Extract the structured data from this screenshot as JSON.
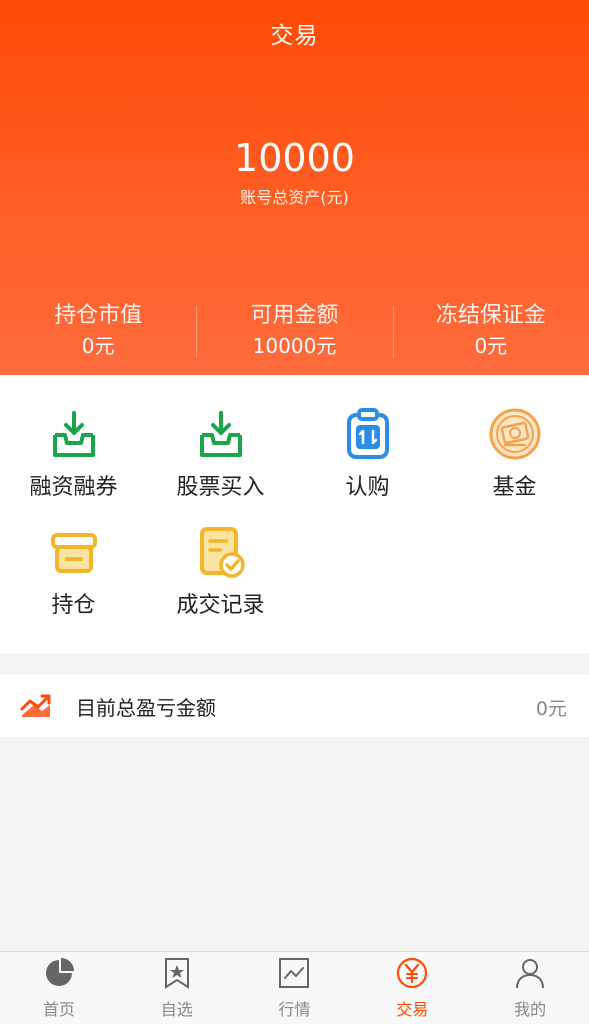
{
  "header": {
    "title": "交易",
    "total_value": "10000",
    "total_label": "账号总资产(元)"
  },
  "stats": [
    {
      "label": "持仓市值",
      "value": "0元"
    },
    {
      "label": "可用金额",
      "value": "10000元"
    },
    {
      "label": "冻结保证金",
      "value": "0元"
    }
  ],
  "menu": [
    {
      "label": "融资融券",
      "icon": "tray-download-icon"
    },
    {
      "label": "股票买入",
      "icon": "tray-download-icon"
    },
    {
      "label": "认购",
      "icon": "clipboard-exchange-icon"
    },
    {
      "label": "基金",
      "icon": "fund-coin-icon"
    },
    {
      "label": "持仓",
      "icon": "archive-box-icon"
    },
    {
      "label": "成交记录",
      "icon": "document-check-icon"
    }
  ],
  "pl": {
    "label": "目前总盈亏金额",
    "value": "0元"
  },
  "tabs": [
    {
      "label": "首页",
      "icon": "pie-chart-icon"
    },
    {
      "label": "自选",
      "icon": "bookmark-star-icon"
    },
    {
      "label": "行情",
      "icon": "line-chart-icon"
    },
    {
      "label": "交易",
      "icon": "yen-circle-icon",
      "active": true
    },
    {
      "label": "我的",
      "icon": "user-icon"
    }
  ],
  "colors": {
    "accent": "#ff4a06",
    "green": "#1aa54a",
    "blue": "#2a8ee8",
    "yellow": "#f5b52a",
    "orange": "#f5a24a"
  }
}
